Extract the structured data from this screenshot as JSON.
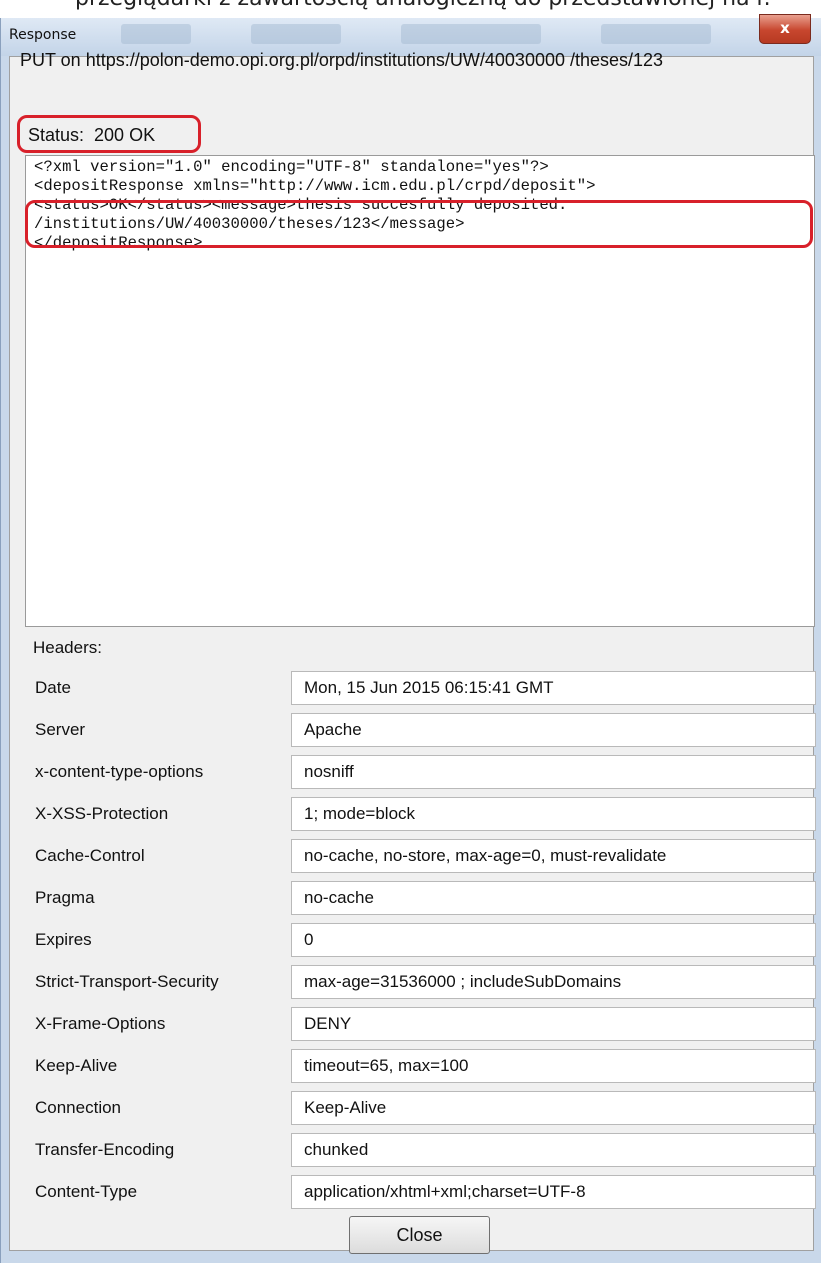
{
  "background": {
    "caption": "przeglądarki z zawartością analogiczną do przedstawionej na r."
  },
  "window": {
    "title": "Response",
    "close_glyph": "x",
    "request_line": "PUT on https://polon-demo.opi.org.pl/orpd/institutions/UW/40030000 /theses/123",
    "status_label": "Status:",
    "status_value": "200 OK",
    "response_body_lines": [
      "<?xml version=\"1.0\" encoding=\"UTF-8\" standalone=\"yes\"?>",
      "<depositResponse xmlns=\"http://www.icm.edu.pl/crpd/deposit\">",
      "<status>OK</status><message>thesis succesfully deposited:",
      "/institutions/UW/40030000/theses/123</message>",
      "</depositResponse>"
    ],
    "headers_label": "Headers:",
    "headers": [
      {
        "key": "Date",
        "value": "Mon, 15 Jun 2015 06:15:41 GMT"
      },
      {
        "key": "Server",
        "value": "Apache"
      },
      {
        "key": "x-content-type-options",
        "value": "nosniff"
      },
      {
        "key": "X-XSS-Protection",
        "value": "1; mode=block"
      },
      {
        "key": "Cache-Control",
        "value": "no-cache, no-store, max-age=0, must-revalidate"
      },
      {
        "key": "Pragma",
        "value": "no-cache"
      },
      {
        "key": "Expires",
        "value": "0"
      },
      {
        "key": "Strict-Transport-Security",
        "value": "max-age=31536000 ; includeSubDomains"
      },
      {
        "key": "X-Frame-Options",
        "value": "DENY"
      },
      {
        "key": "Keep-Alive",
        "value": "timeout=65, max=100"
      },
      {
        "key": "Connection",
        "value": "Keep-Alive"
      },
      {
        "key": "Transfer-Encoding",
        "value": "chunked"
      },
      {
        "key": "Content-Type",
        "value": "application/xhtml+xml;charset=UTF-8"
      }
    ],
    "close_button_label": "Close"
  },
  "colors": {
    "highlight": "#d8202a",
    "titlebar": "#c3d4e8",
    "close": "#c7462e"
  }
}
